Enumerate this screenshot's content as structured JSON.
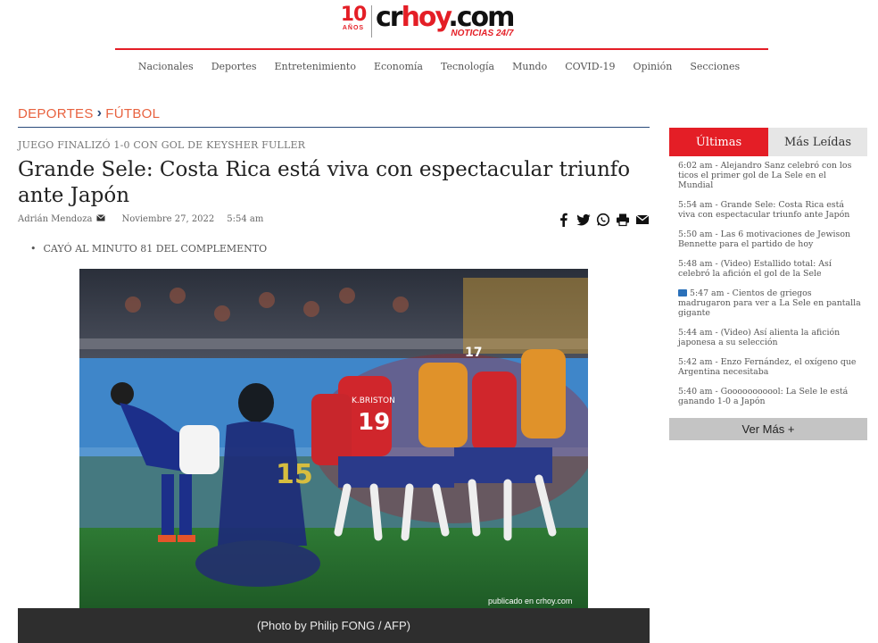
{
  "logo": {
    "ten": "10",
    "years": "AÑOS",
    "word_a": "cr",
    "word_b": "hoy",
    "word_c": ".com",
    "tagline": "NOTICIAS 24/7"
  },
  "nav": [
    "Nacionales",
    "Deportes",
    "Entretenimiento",
    "Economía",
    "Tecnología",
    "Mundo",
    "COVID-19",
    "Opinión",
    "Secciones"
  ],
  "breadcrumb": {
    "section": "DEPORTES",
    "subsection": "FÚTBOL"
  },
  "article": {
    "kicker": "JUEGO FINALIZÓ 1-0 CON GOL DE KEYSHER FULLER",
    "title": "Grande Sele: Costa Rica está viva con espectacular triunfo ante Japón",
    "author": "Adrián Mendoza",
    "date": "Noviembre 27, 2022",
    "time": "5:54 am",
    "bullet": "CAYÓ AL MINUTO 81 DEL COMPLEMENTO",
    "watermark": "publicado en crhoy.com",
    "credit": "(Photo by Philip FONG / AFP)",
    "jersey_a": "19",
    "jersey_b": "15",
    "jersey_c": "17",
    "name_on_jersey": "K.BRISTON"
  },
  "sidebar": {
    "tab_latest": "Últimas",
    "tab_popular": "Más Leídas",
    "items": [
      "6:02 am - Alejandro Sanz celebró con los ticos el primer gol de La Sele en el Mundial",
      "5:54 am - Grande Sele: Costa Rica está viva con espectacular triunfo ante Japón",
      "5:50 am - Las 6 motivaciones de Jewison Bennette para el partido de hoy",
      "5:48 am - (Video) Estallido total: Así celebró la afición el gol de la Sele",
      "5:47 am - Cientos de griegos madrugaron para ver a La Sele en pantalla gigante",
      "5:44 am - (Video) Así alienta la afición japonesa a su selección",
      "5:42 am - Enzo Fernández, el oxígeno que Argentina necesitaba",
      "5:40 am - Gooooooooool: La Sele le está ganando 1-0 a Japón"
    ],
    "more_label": "Ver Más +"
  },
  "colors": {
    "brand_red": "#e41e26",
    "breadcrumb": "#e8623f",
    "navy": "#2a4a7a",
    "caption_bg": "#2e2e2e"
  },
  "icons": [
    "mail-icon",
    "facebook-icon",
    "twitter-icon",
    "whatsapp-icon",
    "print-icon",
    "email-icon",
    "camera-icon",
    "chevron-right-icon"
  ]
}
